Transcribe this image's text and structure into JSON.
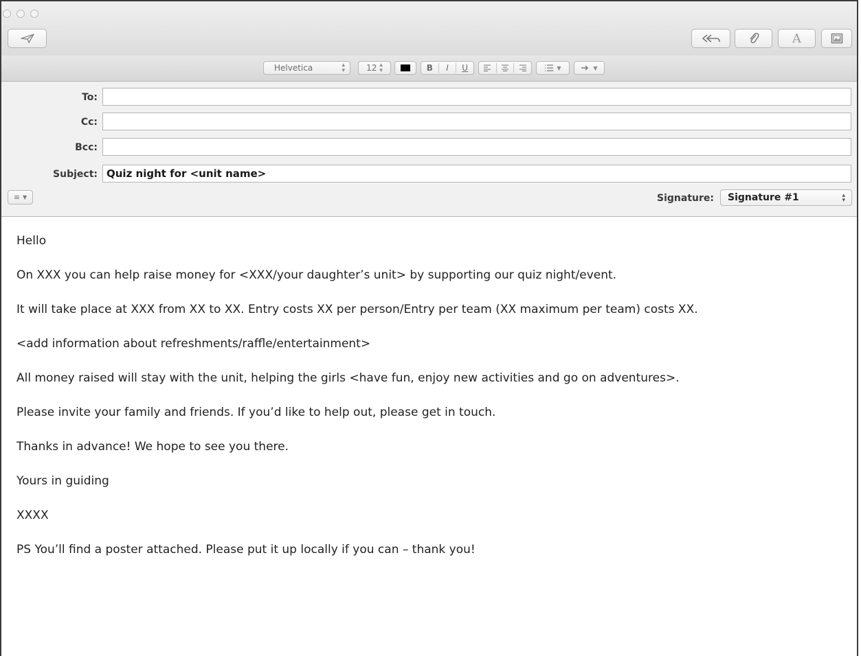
{
  "window": {
    "title": ""
  },
  "toolbar": {
    "send_icon": "paper-plane-icon",
    "buttons": [
      {
        "name": "reply-all-icon"
      },
      {
        "name": "paperclip-icon"
      },
      {
        "name": "font-icon",
        "glyph": "A"
      },
      {
        "name": "photo-browser-icon"
      }
    ]
  },
  "formatbar": {
    "font": "Helvetica",
    "size": "12",
    "color": "#000000",
    "bold": "B",
    "italic": "I",
    "underline": "U"
  },
  "headers": {
    "to_label": "To:",
    "to_value": "",
    "cc_label": "Cc:",
    "cc_value": "",
    "bcc_label": "Bcc:",
    "bcc_value": "",
    "subject_label": "Subject:",
    "subject_value": "Quiz night for <unit name>",
    "signature_label": "Signature:",
    "signature_value": "Signature #1"
  },
  "body": {
    "paragraphs": [
      "Hello",
      "On XXX you can help raise money for <XXX/your daughter’s unit> by supporting our quiz night/event.",
      "It will take place at XXX from XX to XX. Entry costs XX per person/Entry per team (XX maximum per team) costs XX.",
      "<add information about refreshments/raffle/entertainment>",
      "All money raised will stay with the unit, helping the girls <have fun, enjoy new activities and go on adventures>.",
      "Please invite your family and friends. If you’d like to help out, please get in touch.",
      "Thanks in advance! We hope to see you there.",
      "Yours in guiding",
      "XXXX",
      "PS You’ll find a poster attached. Please put it up locally if you can – thank you!"
    ]
  }
}
